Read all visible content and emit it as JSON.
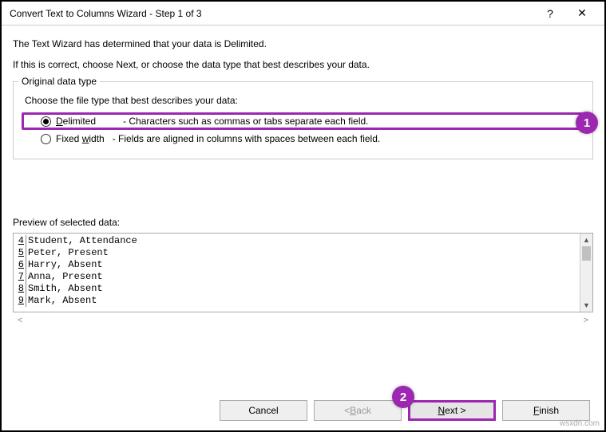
{
  "titlebar": {
    "title": "Convert Text to Columns Wizard - Step 1 of 3",
    "help": "?",
    "close": "✕"
  },
  "intro": {
    "line1": "The Text Wizard has determined that your data is Delimited.",
    "line2": "If this is correct, choose Next, or choose the data type that best describes your data."
  },
  "group": {
    "legend": "Original data type",
    "choose": "Choose the file type that best describes your data:",
    "delimited": {
      "label_u": "D",
      "label_rest": "elimited",
      "desc": "- Characters such as commas or tabs separate each field.",
      "checked": true
    },
    "fixed": {
      "label_pre": "Fixed ",
      "label_u": "w",
      "label_rest": "idth",
      "desc": "- Fields are aligned in columns with spaces between each field.",
      "checked": false
    }
  },
  "preview": {
    "label": "Preview of selected data:",
    "rows": [
      {
        "n": "4",
        "t": "Student, Attendance"
      },
      {
        "n": "5",
        "t": "Peter, Present"
      },
      {
        "n": "6",
        "t": "Harry, Absent"
      },
      {
        "n": "7",
        "t": "Anna, Present"
      },
      {
        "n": "8",
        "t": "Smith, Absent"
      },
      {
        "n": "9",
        "t": "Mark, Absent"
      }
    ]
  },
  "buttons": {
    "cancel": "Cancel",
    "back": "< ",
    "back_u": "B",
    "back_rest": "ack",
    "next_u": "N",
    "next_rest": "ext >",
    "finish_u": "F",
    "finish_rest": "inish"
  },
  "badges": {
    "b1": "1",
    "b2": "2"
  },
  "watermark": "wsxdn.com"
}
